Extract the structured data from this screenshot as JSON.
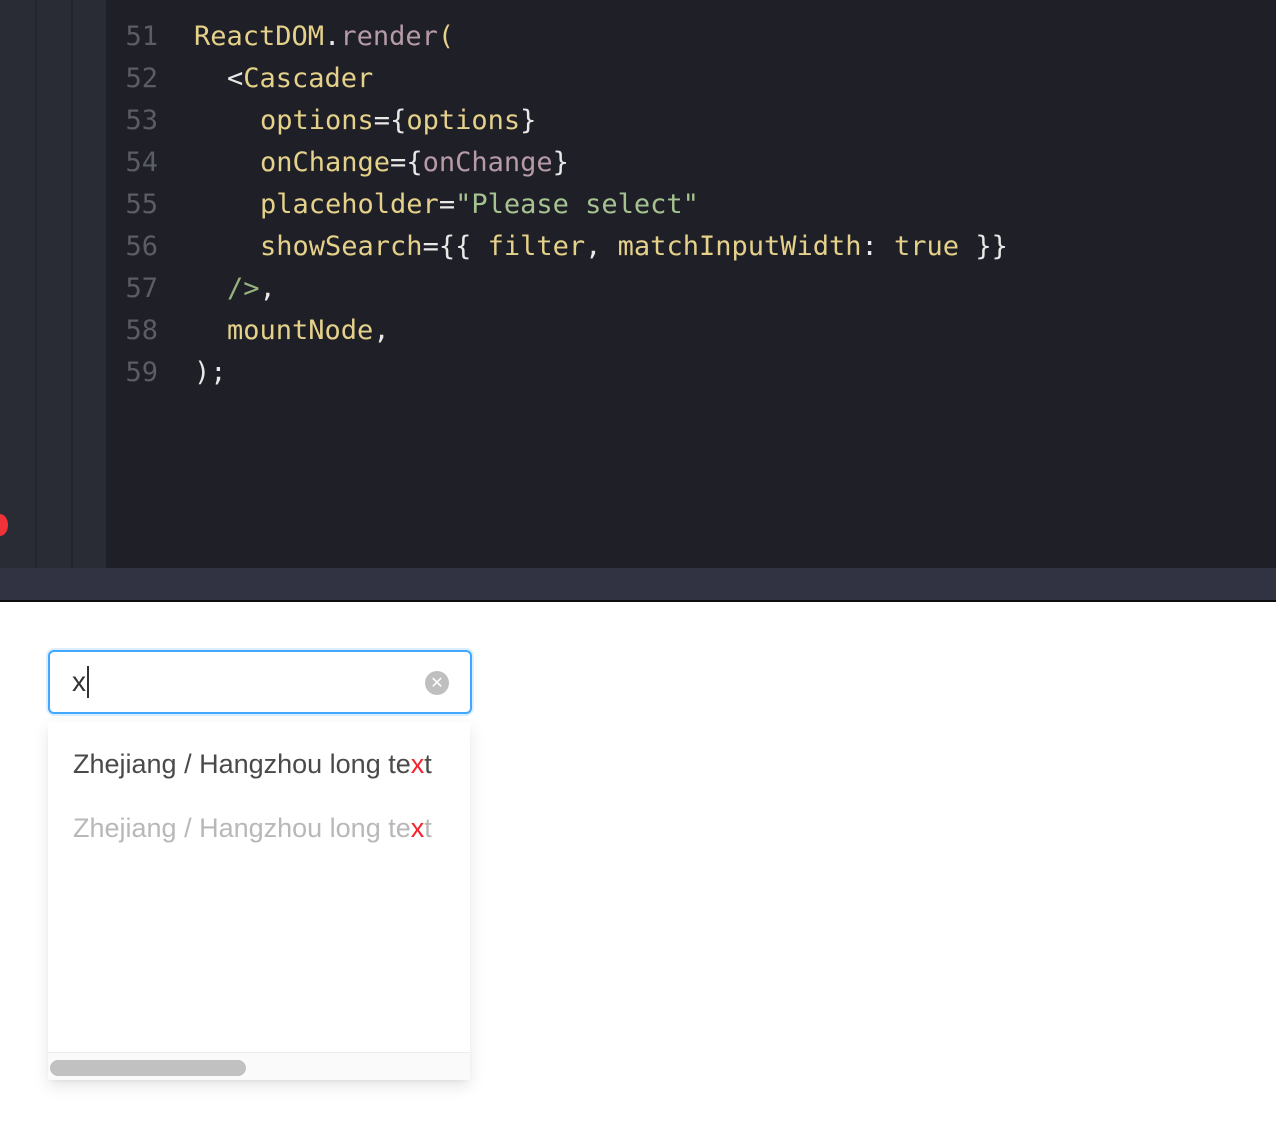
{
  "editor": {
    "line_numbers": [
      "51",
      "52",
      "53",
      "54",
      "55",
      "56",
      "57",
      "58",
      "59"
    ],
    "code": {
      "l51": {
        "a": "ReactDOM",
        "b": ".",
        "c": "render",
        "d": "("
      },
      "l52": {
        "a": "<",
        "b": "Cascader"
      },
      "l53": {
        "a": "options",
        "b": "=",
        "c": "{",
        "d": "options",
        "e": "}"
      },
      "l54": {
        "a": "onChange",
        "b": "=",
        "c": "{",
        "d": "onChange",
        "e": "}"
      },
      "l55": {
        "a": "placeholder",
        "b": "=",
        "c": "\"Please select\""
      },
      "l56": {
        "a": "showSearch",
        "b": "=",
        "c": "{{ ",
        "d": "filter",
        "e": ", ",
        "f": "matchInputWidth",
        "g": ": ",
        "h": "true",
        "i": " }}"
      },
      "l57": {
        "a": "/>",
        "b": ","
      },
      "l58": {
        "a": "mountNode",
        "b": ","
      },
      "l59": {
        "a": ");"
      }
    }
  },
  "cascader": {
    "input_value": "x",
    "clear_icon": "close-circle-icon",
    "options": [
      {
        "pre": "Zhejiang / Hangzhou long te",
        "match": "x",
        "post": "t",
        "disabled": false
      },
      {
        "pre": "Zhejiang / Hangzhou long te",
        "match": "x",
        "post": "t",
        "disabled": true
      }
    ]
  },
  "colors": {
    "editor_bg": "#1f2027",
    "focus_border": "#40a9ff",
    "highlight": "#f5222d",
    "error_dot": "#f0323a"
  }
}
